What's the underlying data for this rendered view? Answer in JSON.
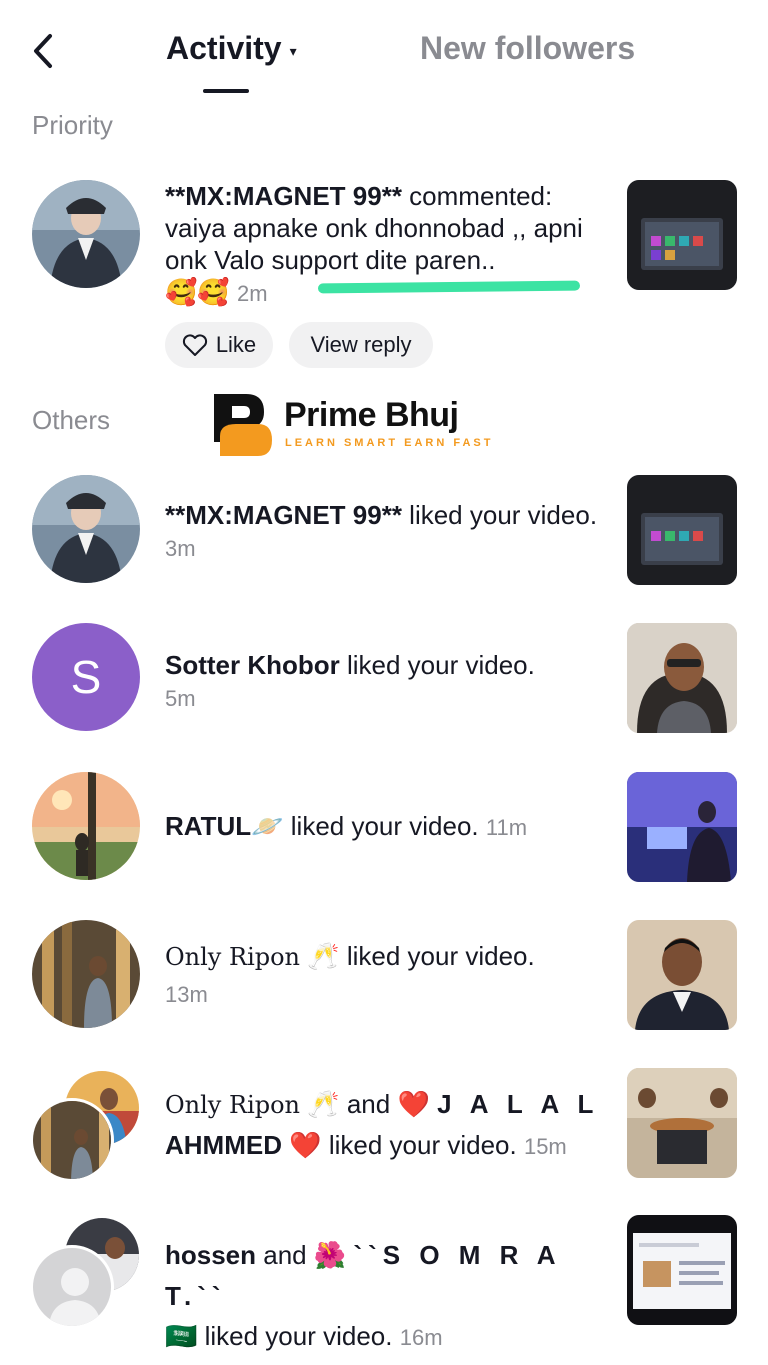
{
  "header": {
    "tab_activity": "Activity",
    "tab_activity_caret": "▾",
    "tab_followers": "New followers"
  },
  "sections": {
    "priority": "Priority",
    "others": "Others"
  },
  "priority": {
    "username": "**MX:MAGNET 99**",
    "action": " commented: vaiya apnake onk dhonnobad ,, apni onk Valo support dite paren..",
    "emojis": "🥰🥰",
    "time": "2m",
    "like_label": "Like",
    "view_reply_label": "View reply"
  },
  "logo": {
    "title": "Prime Bhuj",
    "tagline": "LEARN SMART EARN FAST"
  },
  "others": [
    {
      "username": "**MX:MAGNET 99**",
      "action": " liked your video.",
      "time": "3m"
    },
    {
      "username": "Sotter Khobor",
      "action": " liked your video.",
      "time": "5m",
      "avatar_letter": "S"
    },
    {
      "username": "RATUL",
      "emoji": "🪐",
      "action": " liked your video.",
      "time": "11m"
    },
    {
      "username": "Only Ripon",
      "emoji": "🥂",
      "action": " liked your video.",
      "time": "13m"
    },
    {
      "username1": "Only Ripon",
      "emoji1": "🥂",
      "conj": " and ",
      "emoji2": "❤️",
      "username2a": "J A L A L",
      "username2b": "AHMMED",
      "emoji3": "❤️",
      "action": " liked your video.",
      "time": "15m"
    },
    {
      "username1": "hossen",
      "conj": " and ",
      "emoji1": "🌺",
      "username2": "``S O M R A T.``",
      "emoji2": "🇸🇦",
      "action": " liked your video.",
      "time": "16m"
    }
  ],
  "colors": {
    "accent_green": "#3ce3a3",
    "avatar_purple": "#8b5fc9",
    "logo_orange": "#f39a1f"
  }
}
